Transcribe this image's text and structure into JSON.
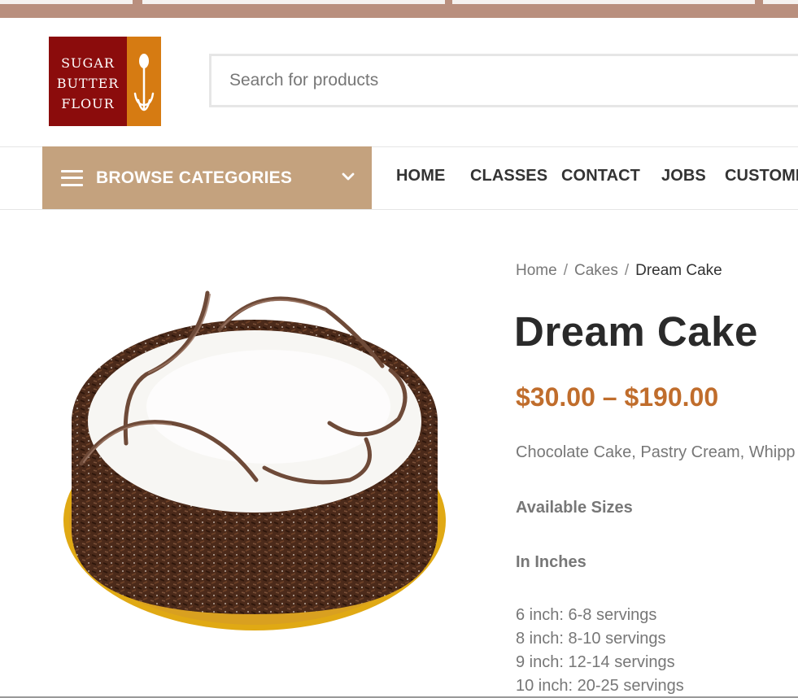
{
  "logo": {
    "lines": [
      "SUGAR",
      "BUTTER",
      "FLOUR"
    ],
    "colors": {
      "left": "#8b0c0c",
      "right": "#d67b12"
    }
  },
  "search": {
    "placeholder": "Search for products"
  },
  "nav": {
    "browse_label": "BROWSE CATEGORIES",
    "items": [
      "HOME",
      "CLASSES",
      "CONTACT",
      "JOBS",
      "CUSTOMI"
    ]
  },
  "breadcrumb": {
    "home": "Home",
    "separator": "/",
    "category": "Cakes",
    "current": "Dream Cake"
  },
  "product": {
    "title": "Dream Cake",
    "price": "$30.00 – $190.00",
    "description": "Chocolate Cake, Pastry Cream, Whipp",
    "available_sizes_heading": "Available Sizes",
    "units_heading": "In Inches",
    "sizes": [
      "6 inch: 6-8 servings",
      "8 inch: 8-10 servings",
      "9 inch: 12-14 servings",
      "10 inch: 20-25 servings"
    ]
  },
  "colors": {
    "topbar": "#b98f7e",
    "browse_bg": "#c4a27e",
    "price": "#c06d2c"
  }
}
